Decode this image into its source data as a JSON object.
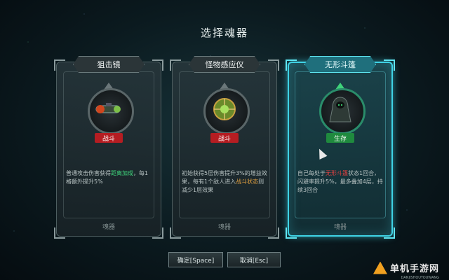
{
  "title": "选择魂器",
  "cards": [
    {
      "name": "狙击镜",
      "tag": "战斗",
      "tag_color": "#b51d22",
      "icon": "scope-icon",
      "desc_parts": [
        "普通攻击伤害获得",
        "距离加成",
        "，每1格额外提升5%"
      ],
      "footer": "魂器",
      "selected": false
    },
    {
      "name": "怪物感应仪",
      "tag": "战斗",
      "tag_color": "#b51d22",
      "icon": "sensor-orb-icon",
      "desc_parts": [
        "初始获得5层伤害提升3%的增益效果，每有1个敌人进入",
        "战斗状态",
        "则减少1层效果"
      ],
      "footer": "魂器",
      "selected": false
    },
    {
      "name": "无形斗篷",
      "tag": "生存",
      "tag_color": "#1f8a3e",
      "icon": "cloak-icon",
      "desc_parts": [
        "自己每处于",
        "无形斗篷",
        "状态1回合，闪避率提升5%，最多叠加4层，持续3回合"
      ],
      "footer": "魂器",
      "selected": true
    }
  ],
  "buttons": {
    "confirm": "确定[Space]",
    "cancel": "取消[Esc]"
  },
  "watermark": {
    "text": "单机手游网",
    "sub": "DANJISHOUYOUWANG"
  }
}
